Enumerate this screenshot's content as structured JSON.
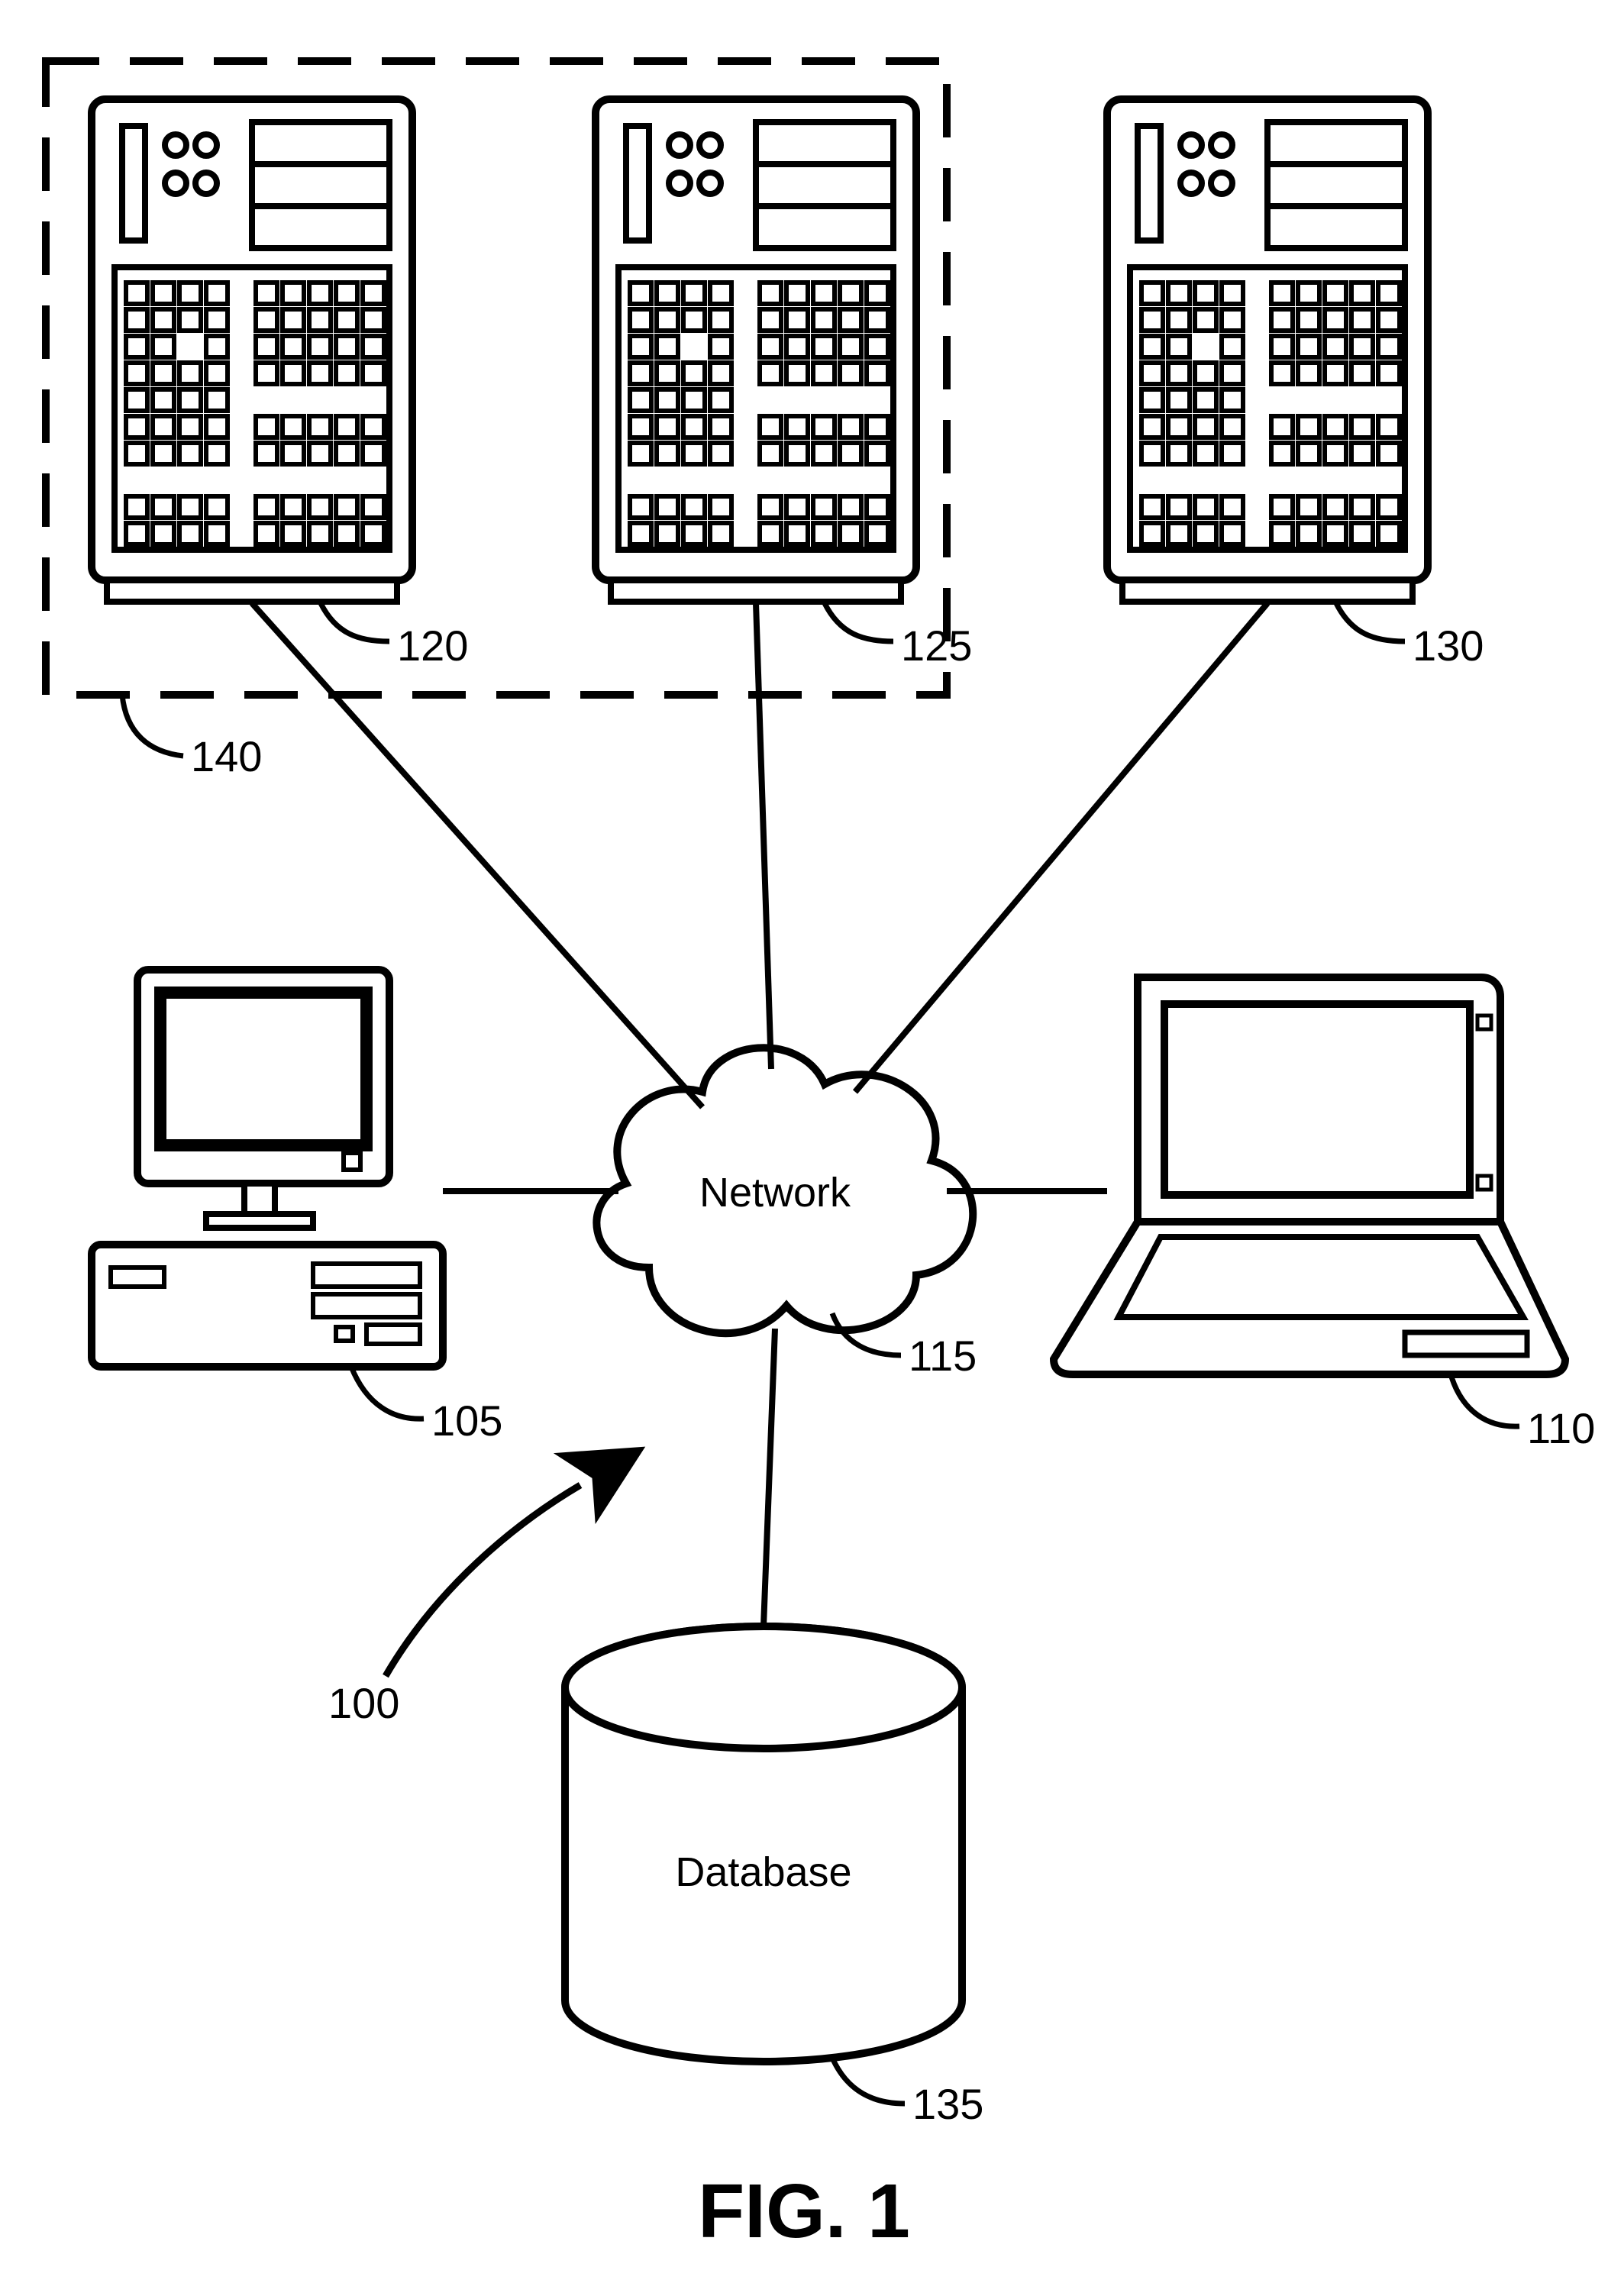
{
  "figure_title": "FIG. 1",
  "network_label": "Network",
  "database_label": "Database",
  "refs": {
    "system": "100",
    "desktop": "105",
    "laptop": "110",
    "network": "115",
    "server1": "120",
    "server2": "125",
    "server3": "130",
    "database": "135",
    "cluster": "140"
  }
}
